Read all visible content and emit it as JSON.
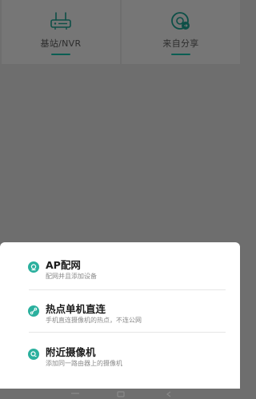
{
  "background_tiles": [
    {
      "label": "基站/NVR",
      "icon": "router-icon"
    },
    {
      "label": "来自分享",
      "icon": "shared-camera-icon"
    }
  ],
  "sheet": {
    "options": [
      {
        "title": "AP配网",
        "subtitle": "配网并且添加设备",
        "icon": "ap-camera-icon"
      },
      {
        "title": "热点单机直连",
        "subtitle": "手机直连摄像机的热点，不连公网",
        "icon": "hotspot-link-icon"
      },
      {
        "title": "附近摄像机",
        "subtitle": "添加同一路由器上的摄像机",
        "icon": "nearby-camera-icon"
      }
    ]
  },
  "colors": {
    "accent": "#2bb09e",
    "underline": "#0b5e53",
    "overlay": "#6e6e6e"
  }
}
